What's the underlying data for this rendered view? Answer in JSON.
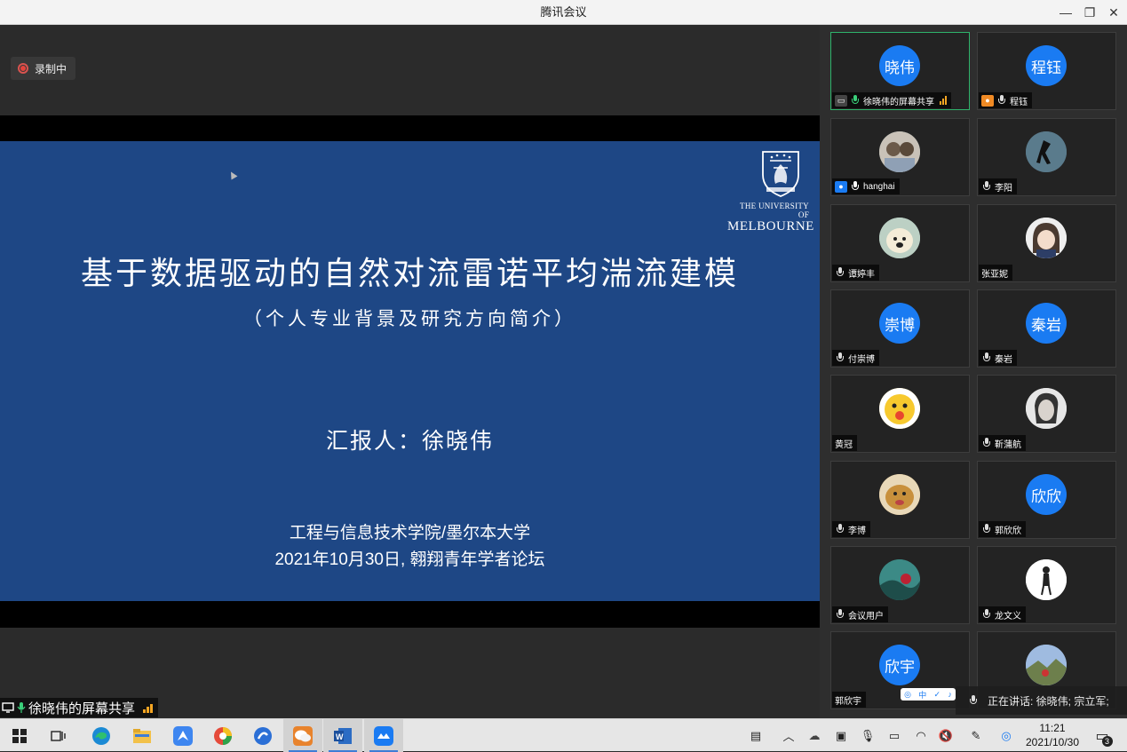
{
  "window": {
    "title": "腾讯会议",
    "minimize_glyph": "—",
    "restore_glyph": "❐",
    "close_glyph": "✕"
  },
  "recording": {
    "label": "录制中"
  },
  "slide": {
    "university_line1": "THE UNIVERSITY OF",
    "university_line2": "MELBOURNE",
    "title": "基于数据驱动的自然对流雷诺平均湍流建模",
    "subtitle": "（个人专业背景及研究方向简介）",
    "reporter": "汇报人：徐晓伟",
    "institution": "工程与信息技术学院/墨尔本大学",
    "date_event": "2021年10月30日, 翱翔青年学者论坛"
  },
  "share_label": "徐晓伟的屏幕共享",
  "participants": [
    {
      "avatar_text": "晓伟",
      "name": "徐晓伟的屏幕共享",
      "mic": "on",
      "icon": "screen-share-icon"
    },
    {
      "avatar_text": "程钰",
      "name": "程钰",
      "mic": "muted",
      "icon": "user-orange-icon"
    },
    {
      "avatar_text": "",
      "name": "hanghai",
      "mic": "on-white",
      "icon": "user-blue-icon"
    },
    {
      "avatar_text": "",
      "name": "李阳",
      "mic": "muted",
      "icon": ""
    },
    {
      "avatar_text": "",
      "name": "谭婷丰",
      "mic": "muted",
      "icon": ""
    },
    {
      "avatar_text": "",
      "name": "张亚妮",
      "mic": "none",
      "icon": ""
    },
    {
      "avatar_text": "崇博",
      "name": "付崇博",
      "mic": "muted",
      "icon": ""
    },
    {
      "avatar_text": "秦岩",
      "name": "秦岩",
      "mic": "muted",
      "icon": ""
    },
    {
      "avatar_text": "",
      "name": "黄冠",
      "mic": "none",
      "icon": ""
    },
    {
      "avatar_text": "",
      "name": "靳蒲航",
      "mic": "muted",
      "icon": ""
    },
    {
      "avatar_text": "",
      "name": "李博",
      "mic": "muted",
      "icon": ""
    },
    {
      "avatar_text": "欣欣",
      "name": "郭欣欣",
      "mic": "muted",
      "icon": ""
    },
    {
      "avatar_text": "",
      "name": "会议用户",
      "mic": "muted",
      "icon": ""
    },
    {
      "avatar_text": "",
      "name": "龙文义",
      "mic": "muted",
      "icon": ""
    },
    {
      "avatar_text": "欣宇",
      "name": "郭欣宇",
      "mic": "none",
      "icon": ""
    },
    {
      "avatar_text": "",
      "name": "",
      "mic": "none",
      "icon": ""
    }
  ],
  "speaking": {
    "label": "正在讲话: 徐晓伟; 宗立军;"
  },
  "ime_bar": {
    "label": "中"
  },
  "taskbar": {
    "time": "11:21",
    "date": "2021/10/30",
    "notification_count": "3"
  },
  "colors": {
    "slide_bg": "#1e4785",
    "avatar_blue": "#1a7bf2",
    "active_border": "#2fb36b",
    "signal": "#f5a623"
  }
}
